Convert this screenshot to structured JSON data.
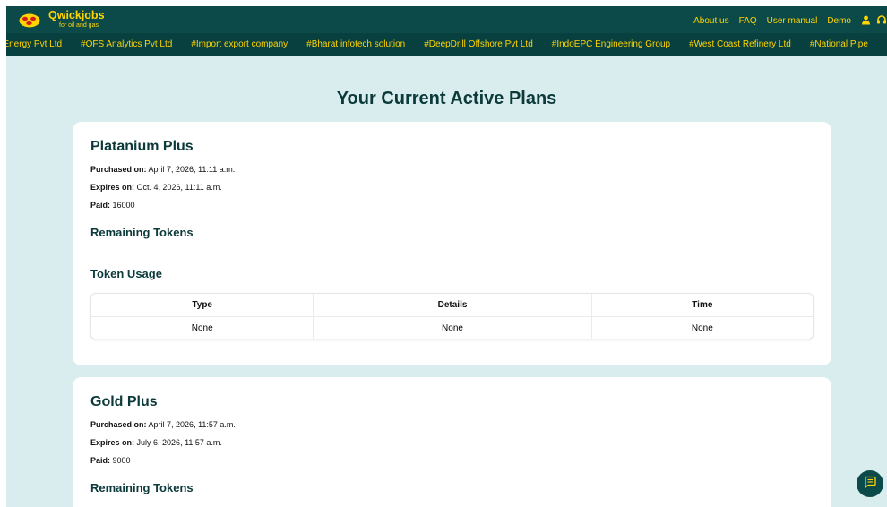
{
  "header": {
    "logo_name": "Qwickjobs",
    "logo_tagline": "for oil and gas",
    "nav": [
      "About us",
      "FAQ",
      "User manual",
      "Demo"
    ],
    "icons": [
      "user-icon",
      "headset-icon"
    ]
  },
  "ticker": [
    "ill Energy Pvt Ltd",
    "#OFS Analytics Pvt Ltd",
    "#Import export company",
    "#Bharat infotech solution",
    "#DeepDrill Offshore Pvt Ltd",
    "#IndoEPC Engineering Group",
    "#West Coast Refinery Ltd",
    "#National Pipe"
  ],
  "page_title": "Your Current Active Plans",
  "plans": [
    {
      "name": "Platanium Plus",
      "purchased_label": "Purchased on:",
      "purchased": "April 7, 2026, 11:11 a.m.",
      "expires_label": "Expires on:",
      "expires": "Oct. 4, 2026, 11:11 a.m.",
      "paid_label": "Paid:",
      "paid": "16000",
      "remaining_tokens_label": "Remaining Tokens",
      "token_usage_label": "Token Usage",
      "table": {
        "headers": [
          "Type",
          "Details",
          "Time"
        ],
        "rows": [
          [
            "None",
            "None",
            "None"
          ]
        ]
      }
    },
    {
      "name": "Gold Plus",
      "purchased_label": "Purchased on:",
      "purchased": "April 7, 2026, 11:57 a.m.",
      "expires_label": "Expires on:",
      "expires": "July 6, 2026, 11:57 a.m.",
      "paid_label": "Paid:",
      "paid": "9000",
      "remaining_tokens_label": "Remaining Tokens"
    }
  ],
  "colors": {
    "header_bg": "#0c4a4a",
    "accent_yellow": "#ffd400",
    "page_bg": "#d9edee",
    "heading_text": "#0c3a3a"
  },
  "chat_icon": "chat-icon"
}
